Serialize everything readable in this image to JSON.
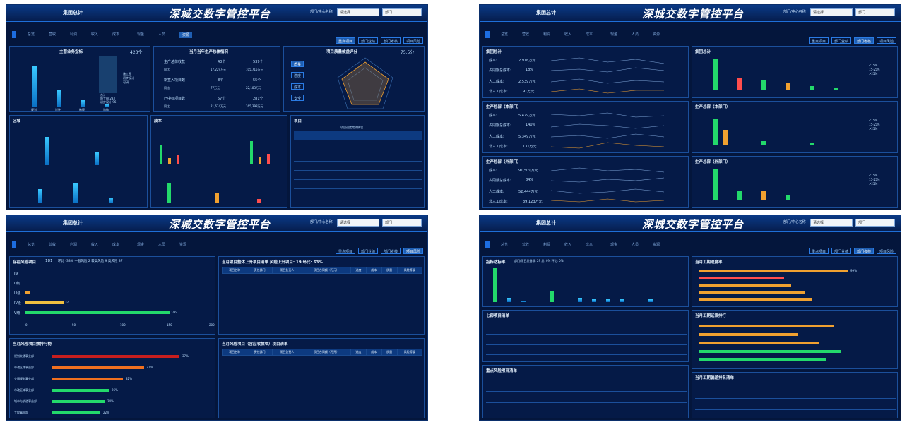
{
  "header": {
    "group_label": "集团总计",
    "title": "深城交数字管控平台",
    "ctl_label": "部门/中心名称",
    "select1": "请选择",
    "select2": "部门"
  },
  "tabs": [
    "总览",
    "营收",
    "利润",
    "收入",
    "成本",
    "现金",
    "人员",
    "资源"
  ],
  "right_btns": [
    "重点项目",
    "部门业绩",
    "部门考核",
    "项目风险"
  ],
  "s1": {
    "kpi_title": "主营业务指标",
    "kpi_value": "423个",
    "prod_title": "当月当年生产总体情况",
    "rows": [
      {
        "label": "生产总体收款",
        "v1": "40个",
        "v2": "539个"
      },
      {
        "label": "同比",
        "v1": "17,229万元",
        "v2": "105,715万元"
      },
      {
        "label": "新签入项目数",
        "v1": "8个",
        "v2": "55个"
      },
      {
        "label": "同比",
        "v1": "77万元",
        "v2": "22,183万元"
      },
      {
        "label": "已中标项目数",
        "v1": "57个",
        "v2": "281个"
      },
      {
        "label": "同比",
        "v1": "21,674万元",
        "v2": "165,398万元"
      }
    ],
    "radar_title": "项目质量效益评分",
    "radar_score": "75.5分",
    "radar_btns": [
      "质量",
      "进度",
      "成本",
      "安全"
    ],
    "bars": [
      683,
      291,
      118,
      52
    ],
    "bar_cats": [
      "规划",
      "设计",
      "勘察",
      "咨询"
    ],
    "legend": [
      "施工图",
      "初步设计",
      "可研",
      "方案阶段"
    ],
    "legend_note": [
      "合计",
      "施工图:233",
      "初步设计:96",
      "可研:56"
    ],
    "zone": "区域",
    "cost": "成本",
    "table_title": "项目",
    "table_sub": "项目进度完成情况"
  },
  "s2": {
    "sections": [
      {
        "title": "集团总计",
        "rows": [
          [
            "成本:",
            "2,916万元"
          ],
          [
            "占同期总成本:",
            "18%"
          ],
          [
            "人工成本:",
            "2,539万元"
          ],
          [
            "非人工成本:",
            "91万元"
          ]
        ]
      },
      {
        "title": "生产总部（本部门）",
        "rows": [
          [
            "成本:",
            "5,479万元"
          ],
          [
            "占同期总成本:",
            "140%"
          ],
          [
            "人工成本:",
            "5,349万元"
          ],
          [
            "非人工成本:",
            "131万元"
          ]
        ]
      },
      {
        "title": "生产总部（外部门）",
        "rows": [
          [
            "成本:",
            "91,509万元"
          ],
          [
            "占同期总成本:",
            "84%"
          ],
          [
            "人工成本:",
            "52,444万元"
          ],
          [
            "非人工成本:",
            "39,123万元"
          ]
        ]
      }
    ],
    "chart_titles": [
      "集团总计",
      "生产总部（本部门）",
      "生产总部（外部门）"
    ],
    "chart_legend": [
      "<15%",
      "15-25%",
      ">25%"
    ]
  },
  "s3": {
    "risk_title": "存在风险项目",
    "risk_total": "181",
    "risk_stats": "环比 -38%   一般风险 2   较高风险 9   高风险 37",
    "levels": [
      {
        "label": "I级",
        "value": 0
      },
      {
        "label": "II级",
        "value": 0
      },
      {
        "label": "III级",
        "value": 5
      },
      {
        "label": "IV级",
        "value": 37
      },
      {
        "label": "V级",
        "value": 146
      }
    ],
    "axis": [
      "0",
      "50",
      "100",
      "150",
      "200"
    ],
    "dept_title": "当月风险项目数排行榜",
    "depts": [
      {
        "name": "规划交通事业部",
        "pct": "37%"
      },
      {
        "name": "市政区域事业部",
        "pct": "41%"
      },
      {
        "name": "交通规划事业部",
        "pct": "32%"
      },
      {
        "name": "市政区域事业部",
        "pct": "26%"
      },
      {
        "name": "城市与轨道事业部",
        "pct": "24%"
      },
      {
        "name": "工程事业部",
        "pct": "22%"
      }
    ],
    "t1_title": "当月项目整体上升项目清单   风险上升项目: 19   环比: 63%",
    "t2_title": "当月风险项目（含应收款项）项目清单",
    "cols": [
      "项目名称",
      "责任部门",
      "项目负责人",
      "项目合同额（万元）",
      "进度",
      "成本",
      "质量",
      "风险等级"
    ]
  },
  "s4": {
    "top_title": "指标达标率",
    "top_sub": "部门/项目总指标: 29  总: 0%  环比: 0%",
    "bars": [
      433,
      56,
      16,
      128,
      0,
      47,
      21,
      20,
      19,
      20,
      5
    ],
    "t_titles": [
      "七部项目清单",
      "重点风险项目清单"
    ],
    "r_titles": [
      "当月工期进度率",
      "当月工期延误排行",
      "当月工期偏差排名清单"
    ],
    "r_pcts": [
      "99%",
      "60%",
      "60%",
      "60%",
      "60%"
    ]
  }
}
